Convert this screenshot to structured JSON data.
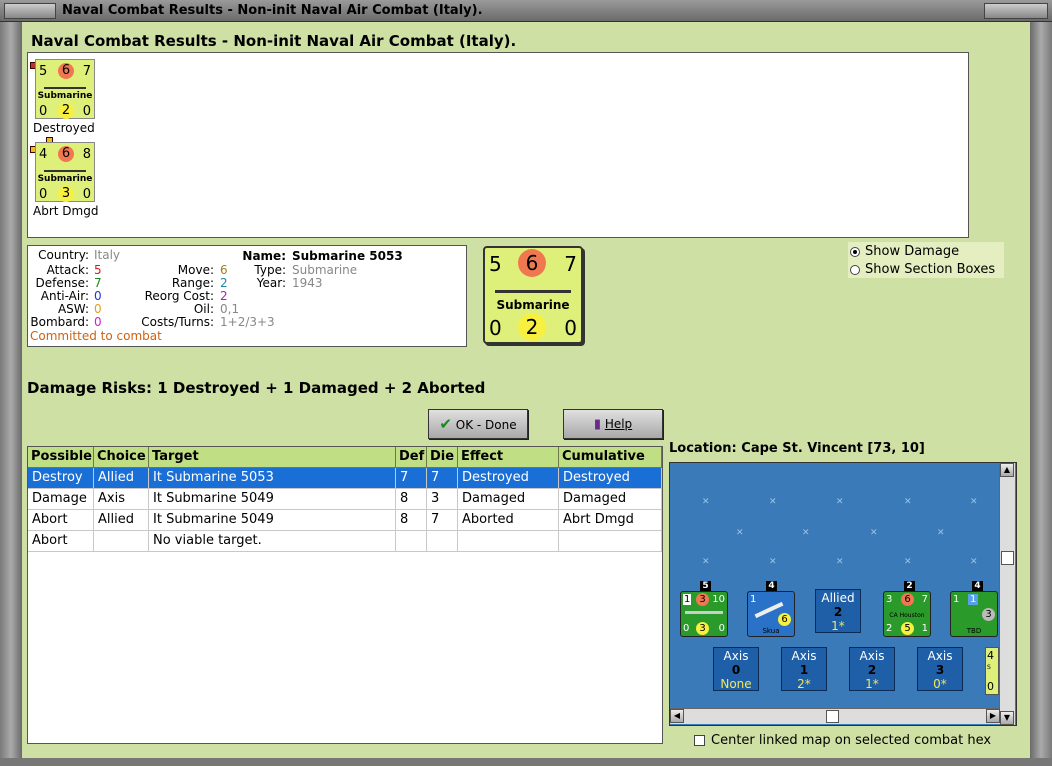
{
  "window": {
    "title": "Naval Combat Results - Non-init Naval Air Combat (Italy)."
  },
  "heading": "Naval Combat Results - Non-init Naval Air Combat (Italy).",
  "units": [
    {
      "att": "5",
      "def": "6",
      "move": "7",
      "name": "Submarine",
      "bl": "0",
      "bm": "2",
      "br": "0",
      "status": "Destroyed"
    },
    {
      "att": "4",
      "def": "6",
      "move": "8",
      "name": "Submarine",
      "bl": "0",
      "bm": "3",
      "br": "0",
      "status": "Abrt Dmgd"
    }
  ],
  "info": {
    "country_label": "Country:",
    "country": "Italy",
    "attack_label": "Attack:",
    "attack": "5",
    "defense_label": "Defense:",
    "defense": "7",
    "antiair_label": "Anti-Air:",
    "antiair": "0",
    "asw_label": "ASW:",
    "asw": "0",
    "bombard_label": "Bombard:",
    "bombard": "0",
    "move_label": "Move:",
    "move": "6",
    "range_label": "Range:",
    "range": "2",
    "reorg_label": "Reorg Cost:",
    "reorg": "2",
    "oil_label": "Oil:",
    "oil": "0,1",
    "costs_label": "Costs/Turns:",
    "costs": "1+2/3+3",
    "name_label": "Name:",
    "name": "Submarine 5053",
    "type_label": "Type:",
    "type": "Submarine",
    "year_label": "Year:",
    "year": "1943",
    "status": "Committed to combat"
  },
  "bigcounter": {
    "tl": "5",
    "tm": "6",
    "tr": "7",
    "name": "Submarine",
    "bl": "0",
    "bm": "2",
    "br": "0"
  },
  "options": {
    "show_damage": "Show Damage",
    "show_boxes": "Show Section Boxes",
    "selected": "show_damage"
  },
  "damage_risks": "Damage Risks:  1 Destroyed + 1 Damaged + 2 Aborted",
  "buttons": {
    "ok": "OK - Done",
    "help": "Help"
  },
  "table": {
    "headers": [
      "Possible",
      "Choice",
      "Target",
      "Def",
      "Die",
      "Effect",
      "Cumulative"
    ],
    "rows": [
      [
        "Destroy",
        "Allied",
        "It Submarine 5053",
        "7",
        "7",
        "Destroyed",
        "Destroyed"
      ],
      [
        "Damage",
        "Axis",
        "It Submarine 5049",
        "8",
        "3",
        "Damaged",
        "Damaged"
      ],
      [
        "Abort",
        "Allied",
        "It Submarine 5049",
        "8",
        "7",
        "Aborted",
        "Abrt Dmgd"
      ],
      [
        "Abort",
        "",
        "No viable target.",
        "",
        "",
        "",
        ""
      ]
    ]
  },
  "location": "Location:  Cape St. Vincent [73, 10]",
  "map": {
    "stacks": [
      {
        "count": "5",
        "tl": "1",
        "tm": "3",
        "tr": "10",
        "bl": "0",
        "bm": "3",
        "br": "0",
        "name": ""
      },
      {
        "count": "4",
        "tl": "1",
        "tm": "",
        "tr": "",
        "bl": "",
        "bm": "6",
        "br": "",
        "name": "Skua"
      },
      {
        "count": "2",
        "tl": "3",
        "tm": "6",
        "tr": "7",
        "bl": "2",
        "bm": "5",
        "br": "1",
        "name": "CA Houston"
      },
      {
        "count": "4",
        "tl": "1",
        "tm": "1",
        "tr": "",
        "bl": "",
        "bm": "3",
        "br": "",
        "name": "TBD"
      }
    ],
    "allied_box": {
      "side": "Allied",
      "num": "2",
      "sub": "1*"
    },
    "axis_boxes": [
      {
        "side": "Axis",
        "num": "0",
        "sub": "None"
      },
      {
        "side": "Axis",
        "num": "1",
        "sub": "2*"
      },
      {
        "side": "Axis",
        "num": "2",
        "sub": "1*"
      },
      {
        "side": "Axis",
        "num": "3",
        "sub": "0*"
      }
    ],
    "edge_counter": {
      "att": "4",
      "bl": "0",
      "name": "S"
    }
  },
  "center_map": "Center linked map on selected combat hex",
  "colors": {
    "panel": "#cfe0a4",
    "counter": "#dff07a",
    "selected_row": "#1a6fd6",
    "sea": "#3a7ab8"
  }
}
